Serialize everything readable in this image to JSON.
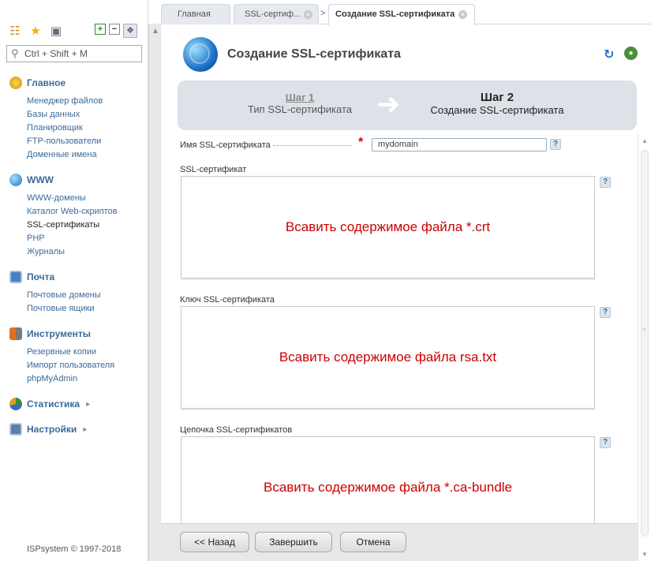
{
  "tabs": [
    {
      "label": "Главная"
    },
    {
      "label": "SSL-сертиф..."
    },
    {
      "label": "Создание SSL-сертификата"
    }
  ],
  "tab_separator": ">",
  "sidebar": {
    "search_placeholder": "Ctrl + Shift + M",
    "sections": [
      {
        "title": "Главное",
        "icon": "home-icon",
        "items": [
          "Менеджер файлов",
          "Базы данных",
          "Планировщик",
          "FTP-пользователи",
          "Доменные имена"
        ]
      },
      {
        "title": "WWW",
        "icon": "globe-icon",
        "items": [
          "WWW-домены",
          "Каталог Web-скриптов",
          "SSL-сертификаты",
          "PHP",
          "Журналы"
        ],
        "active_item": "SSL-сертификаты"
      },
      {
        "title": "Почта",
        "icon": "mail-icon",
        "items": [
          "Почтовые домены",
          "Почтовые ящики"
        ]
      },
      {
        "title": "Инструменты",
        "icon": "tools-icon",
        "items": [
          "Резервные копии",
          "Импорт пользователя",
          "phpMyAdmin"
        ]
      },
      {
        "title": "Статистика",
        "icon": "stats-icon",
        "items": []
      },
      {
        "title": "Настройки",
        "icon": "settings-icon",
        "items": []
      }
    ],
    "copyright": "ISPsystem © 1997-2018"
  },
  "header": {
    "title": "Создание SSL-сертификата"
  },
  "wizard": {
    "step1_num": "Шаг 1",
    "step1_title": "Тип SSL-сертификата",
    "step2_num": "Шаг 2",
    "step2_title": "Создание SSL-сертификата"
  },
  "form": {
    "name_label": "Имя SSL-сертификата",
    "name_value": "mydomain",
    "required_mark": "*",
    "cert_label": "SSL-сертификат",
    "cert_hint": "Всавить содержимое файла *.crt",
    "key_label": "Ключ SSL-сертификата",
    "key_hint": "Всавить содержимое файла rsa.txt",
    "chain_label": "Цепочка SSL-сертификатов",
    "chain_hint": "Всавить содержимое файла *.ca-bundle",
    "help_glyph": "?"
  },
  "buttons": {
    "back": "<< Назад",
    "finish": "Завершить",
    "cancel": "Отмена"
  },
  "colors": {
    "accent": "#3a6a9a",
    "hint_text": "#cc0000",
    "required": "#dd0000",
    "wizard_bg": "#dde2e8"
  }
}
